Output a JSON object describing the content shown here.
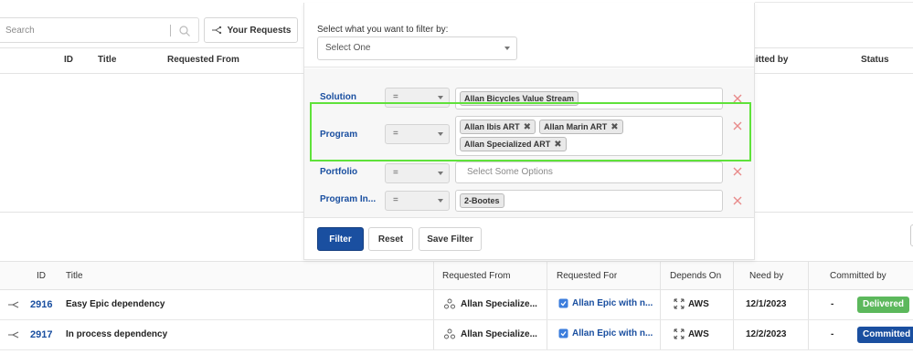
{
  "search": {
    "placeholder": "Search"
  },
  "toolbar": {
    "your_requests": "Your Requests"
  },
  "top_table": {
    "headers": {
      "id": "ID",
      "title": "Title",
      "requested_from": "Requested From",
      "committed_by": "mitted by",
      "status": "Status"
    }
  },
  "filter_panel": {
    "prompt": "Select what you want to filter by:",
    "select_value": "Select One",
    "rows": [
      {
        "label": "Solution",
        "operator": "=",
        "values": [
          "Allan Bicycles Value Stream"
        ],
        "removable": false,
        "placeholder": ""
      },
      {
        "label": "Program",
        "operator": "=",
        "values": [
          "Allan Ibis ART",
          "Allan Marin ART",
          "Allan Specialized ART"
        ],
        "removable": true,
        "placeholder": ""
      },
      {
        "label": "Portfolio",
        "operator": "=",
        "values": [],
        "removable": false,
        "placeholder": "Select Some Options"
      },
      {
        "label": "Program In...",
        "operator": "=",
        "values": [
          "2-Bootes"
        ],
        "removable": false,
        "placeholder": ""
      }
    ],
    "buttons": {
      "filter": "Filter",
      "reset": "Reset",
      "save": "Save Filter"
    }
  },
  "table": {
    "headers": {
      "id": "ID",
      "title": "Title",
      "requested_from": "Requested From",
      "requested_for": "Requested For",
      "depends_on": "Depends On",
      "need_by": "Need by",
      "committed_by": "Committed by"
    },
    "rows": [
      {
        "id": "2916",
        "title": "Easy Epic dependency",
        "requested_from": "Allan Specialize...",
        "requested_for": "Allan Epic with n...",
        "depends_on": "AWS",
        "need_by": "12/1/2023",
        "committed_by": "-",
        "status": "Delivered",
        "status_color": "#5cb85c"
      },
      {
        "id": "2917",
        "title": "In process dependency",
        "requested_from": "Allan Specialize...",
        "requested_for": "Allan Epic with n...",
        "depends_on": "AWS",
        "need_by": "12/2/2023",
        "committed_by": "-",
        "status": "Committed",
        "status_color": "#1a4fa0"
      }
    ]
  },
  "colors": {
    "accent": "#1a4fa0",
    "highlight": "#5fe23a",
    "delete": "#e88a8a"
  }
}
